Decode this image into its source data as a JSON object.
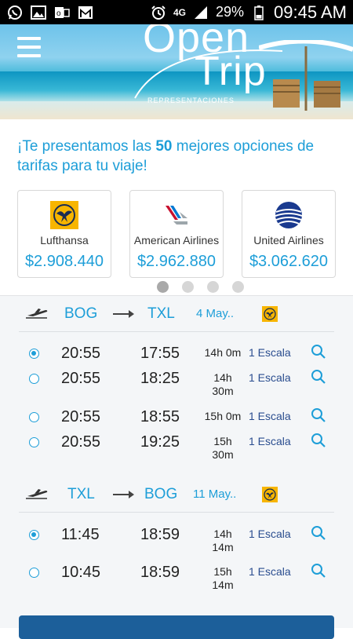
{
  "statusbar": {
    "time": "09:45 AM",
    "battery": "29%",
    "network": "4G"
  },
  "header": {
    "logo_line1": "Open",
    "logo_line2": "Trip",
    "logo_line3": "REPRESENTACIONES"
  },
  "intro": {
    "part1": "¡Te presentamos las ",
    "highlight": "50",
    "part2": " mejores opciones de tarifas para tu viaje!"
  },
  "cards": [
    {
      "name": "Lufthansa",
      "price": "$2.908.440",
      "logo": "lufthansa-logo"
    },
    {
      "name": "American Airlines",
      "price": "$2.962.880",
      "logo": "american-airlines-logo"
    },
    {
      "name": "United Airlines",
      "price": "$3.062.620",
      "logo": "united-airlines-logo"
    }
  ],
  "carousel": {
    "pages": 4,
    "active": 0
  },
  "outbound": {
    "from": "BOG",
    "to": "TXL",
    "date": "4 May..",
    "flights": [
      {
        "dep": "20:55",
        "arr": "17:55",
        "dur1": "14h 0m",
        "dur2": "",
        "stops": "1 Escala",
        "selected": true
      },
      {
        "dep": "20:55",
        "arr": "18:25",
        "dur1": "14h",
        "dur2": "30m",
        "stops": "1 Escala",
        "selected": false
      },
      {
        "dep": "20:55",
        "arr": "18:55",
        "dur1": "15h 0m",
        "dur2": "",
        "stops": "1 Escala",
        "selected": false
      },
      {
        "dep": "20:55",
        "arr": "19:25",
        "dur1": "15h",
        "dur2": "30m",
        "stops": "1 Escala",
        "selected": false
      }
    ]
  },
  "inbound": {
    "from": "TXL",
    "to": "BOG",
    "date": "11 May..",
    "flights": [
      {
        "dep": "11:45",
        "arr": "18:59",
        "dur1": "14h",
        "dur2": "14m",
        "stops": "1 Escala",
        "selected": true
      },
      {
        "dep": "10:45",
        "arr": "18:59",
        "dur1": "15h",
        "dur2": "14m",
        "stops": "1 Escala",
        "selected": false
      }
    ]
  },
  "colors": {
    "accent": "#1d9ed8",
    "lufthansa": "#f7b500",
    "button": "#1c5f9a"
  }
}
